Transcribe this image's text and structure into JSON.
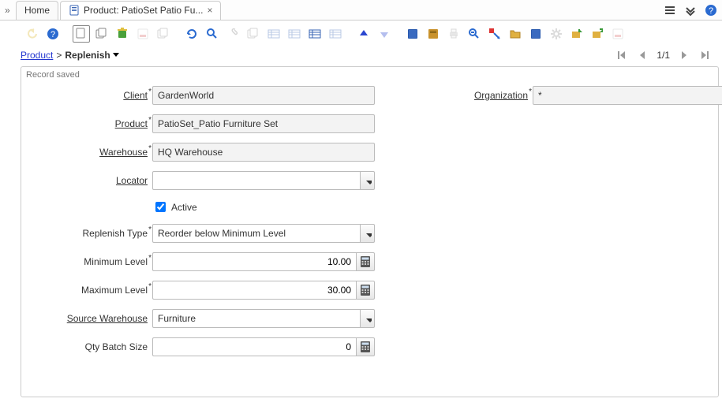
{
  "tabs": {
    "home_label": "Home",
    "product_label": "Product: PatioSet Patio Fu..."
  },
  "breadcrumb": {
    "product": "Product",
    "current": "Replenish"
  },
  "pager": {
    "text": "1/1"
  },
  "status": "Record saved",
  "labels": {
    "client": "Client",
    "organization": "Organization",
    "product": "Product",
    "warehouse": "Warehouse",
    "locator": "Locator",
    "active": "Active",
    "replenish_type": "Replenish Type",
    "minimum_level": "Minimum Level",
    "maximum_level": "Maximum Level",
    "source_warehouse": "Source Warehouse",
    "qty_batch_size": "Qty Batch Size"
  },
  "values": {
    "client": "GardenWorld",
    "organization": "*",
    "product": "PatioSet_Patio Furniture Set",
    "warehouse": "HQ Warehouse",
    "locator": "",
    "active": true,
    "replenish_type": "Reorder below Minimum Level",
    "minimum_level": "10.00",
    "maximum_level": "30.00",
    "source_warehouse": "Furniture",
    "qty_batch_size": "0"
  }
}
